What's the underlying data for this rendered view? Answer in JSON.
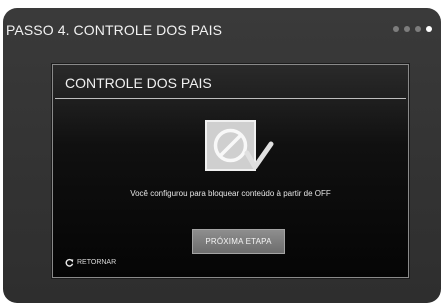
{
  "step": {
    "title": "PASSO 4. CONTROLE DOS PAIS",
    "dots_total": 4,
    "dots_active_index": 4
  },
  "dialog": {
    "title": "CONTROLE DOS PAIS",
    "icon": "no-entry-check-icon",
    "message": "Você configurou para bloquear conteúdo à partir de OFF",
    "next_button_label": "PRÓXIMA ETAPA",
    "return_label": "RETORNAR",
    "return_icon": "return-arrow-icon"
  },
  "colors": {
    "frame": "#343434",
    "dialog": "#0a0a0a",
    "button": "#7d7d7d",
    "text": "#f0f0f0"
  }
}
